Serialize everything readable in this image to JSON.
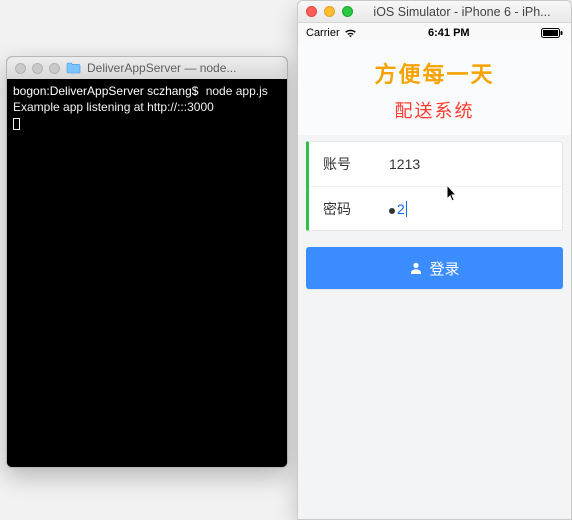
{
  "terminal": {
    "title": "DeliverAppServer — node...",
    "prompt": "bogon:DeliverAppServer sczhang$",
    "command": "node app.js",
    "output_line": "Example app listening at http://:::3000",
    "folder_icon": "folder-icon"
  },
  "simulator": {
    "mac_title": "iOS Simulator - iPhone 6 - iPh...",
    "status": {
      "carrier": "Carrier",
      "time": "6:41 PM",
      "wifi_icon": "wifi-icon",
      "battery_icon": "battery-icon"
    },
    "app": {
      "title1": "方便每一天",
      "title2": "配送系统",
      "fields": {
        "account_label": "账号",
        "account_value": "1213",
        "password_label": "密码",
        "password_masked_count": 1,
        "password_visible_tail": "2"
      },
      "login_label": "登录",
      "login_icon": "person-icon"
    },
    "colors": {
      "accent_blue": "#3b8cff",
      "orange": "#f6a300",
      "red": "#ff3b30",
      "green_border": "#2fbf4a"
    }
  }
}
